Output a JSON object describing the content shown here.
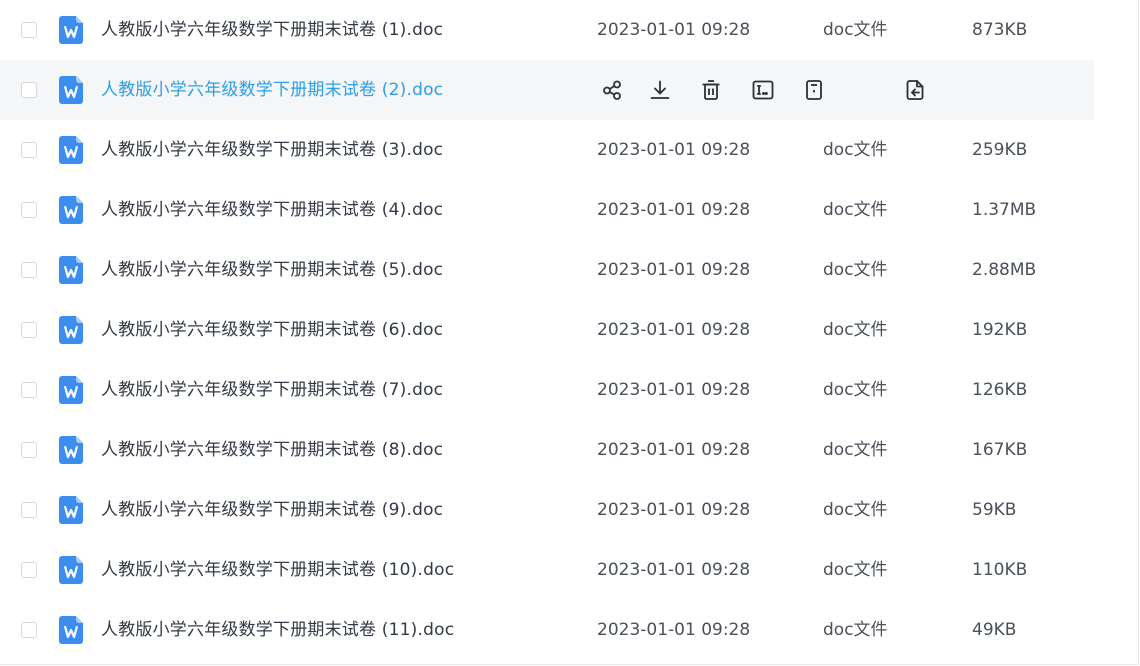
{
  "colors": {
    "accent": "#2a9fe8",
    "file_icon": "#3b8ef0",
    "hover_row": "#f5f6f8",
    "text": "#333a45"
  },
  "hover_actions": [
    {
      "name": "share-icon"
    },
    {
      "name": "download-icon"
    },
    {
      "name": "delete-icon"
    },
    {
      "name": "rename-icon"
    },
    {
      "name": "file-info-icon"
    },
    {
      "name": "move-file-icon"
    }
  ],
  "files": [
    {
      "name": "人教版小学六年级数学下册期末试卷  (1).doc",
      "modified": "2023-01-01 09:28",
      "type": "doc文件",
      "size": "873KB",
      "hovered": false
    },
    {
      "name": "人教版小学六年级数学下册期末试卷  (2).doc",
      "modified": "",
      "type": "",
      "size": "",
      "hovered": true
    },
    {
      "name": "人教版小学六年级数学下册期末试卷  (3).doc",
      "modified": "2023-01-01 09:28",
      "type": "doc文件",
      "size": "259KB",
      "hovered": false
    },
    {
      "name": "人教版小学六年级数学下册期末试卷  (4).doc",
      "modified": "2023-01-01 09:28",
      "type": "doc文件",
      "size": "1.37MB",
      "hovered": false
    },
    {
      "name": "人教版小学六年级数学下册期末试卷  (5).doc",
      "modified": "2023-01-01 09:28",
      "type": "doc文件",
      "size": "2.88MB",
      "hovered": false
    },
    {
      "name": "人教版小学六年级数学下册期末试卷  (6).doc",
      "modified": "2023-01-01 09:28",
      "type": "doc文件",
      "size": "192KB",
      "hovered": false
    },
    {
      "name": "人教版小学六年级数学下册期末试卷  (7).doc",
      "modified": "2023-01-01 09:28",
      "type": "doc文件",
      "size": "126KB",
      "hovered": false
    },
    {
      "name": "人教版小学六年级数学下册期末试卷  (8).doc",
      "modified": "2023-01-01 09:28",
      "type": "doc文件",
      "size": "167KB",
      "hovered": false
    },
    {
      "name": "人教版小学六年级数学下册期末试卷  (9).doc",
      "modified": "2023-01-01 09:28",
      "type": "doc文件",
      "size": "59KB",
      "hovered": false
    },
    {
      "name": "人教版小学六年级数学下册期末试卷  (10).doc",
      "modified": "2023-01-01 09:28",
      "type": "doc文件",
      "size": "110KB",
      "hovered": false
    },
    {
      "name": "人教版小学六年级数学下册期末试卷  (11).doc",
      "modified": "2023-01-01 09:28",
      "type": "doc文件",
      "size": "49KB",
      "hovered": false
    }
  ]
}
